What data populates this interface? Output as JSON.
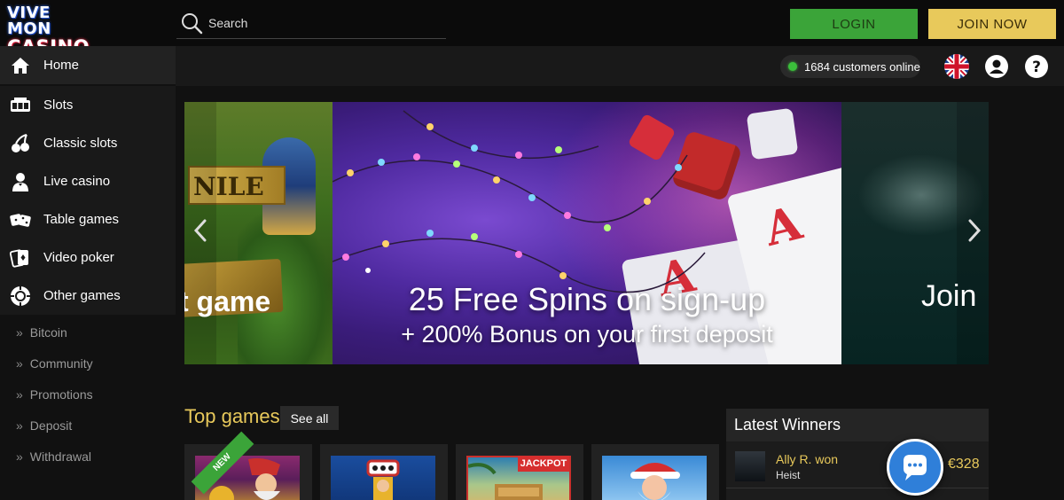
{
  "header": {
    "logo": {
      "line1": "VIVE MON",
      "line2": "CASINO"
    },
    "search": {
      "placeholder": "Search",
      "icon": "search-icon"
    },
    "login_label": "LOGIN",
    "join_label": "JOIN NOW"
  },
  "status": {
    "online_text": "1684 customers online",
    "online_color": "#3bbf3b",
    "language": "English",
    "icons": [
      "flag-uk-icon",
      "user-icon",
      "help-icon"
    ]
  },
  "sidebar": {
    "items": [
      {
        "label": "Home",
        "icon": "home-icon"
      },
      {
        "label": "Slots",
        "icon": "slot-machine-icon"
      },
      {
        "label": "Classic slots",
        "icon": "cherries-icon"
      },
      {
        "label": "Live casino",
        "icon": "dealer-icon"
      },
      {
        "label": "Table games",
        "icon": "dice-icon"
      },
      {
        "label": "Video poker",
        "icon": "cards-icon"
      },
      {
        "label": "Other games",
        "icon": "chip-icon"
      }
    ],
    "sub_items": [
      {
        "label": "Bitcoin"
      },
      {
        "label": "Community"
      },
      {
        "label": "Promotions"
      },
      {
        "label": "Deposit"
      },
      {
        "label": "Withdrawal"
      }
    ]
  },
  "carousel": {
    "left_slide_text": "t game",
    "left_slide_title": "NILE",
    "main_headline": "25 Free Spins on sign-up",
    "main_subline": "+ 200% Bonus on your first deposit",
    "right_slide_text": "Join"
  },
  "top_games": {
    "title": "Top games",
    "see_all_label": "See all",
    "tiles": [
      {
        "badge": "NEW"
      },
      {
        "badge": ""
      },
      {
        "badge": "JACKPOT"
      },
      {
        "badge": ""
      }
    ]
  },
  "winners": {
    "title": "Latest Winners",
    "rows": [
      {
        "name": "Ally R. won",
        "game": "Heist",
        "amount": "€328"
      }
    ]
  },
  "colors": {
    "accent_gold": "#e8c95b",
    "login_green": "#3ba439",
    "chat_blue": "#2f7fd9"
  }
}
